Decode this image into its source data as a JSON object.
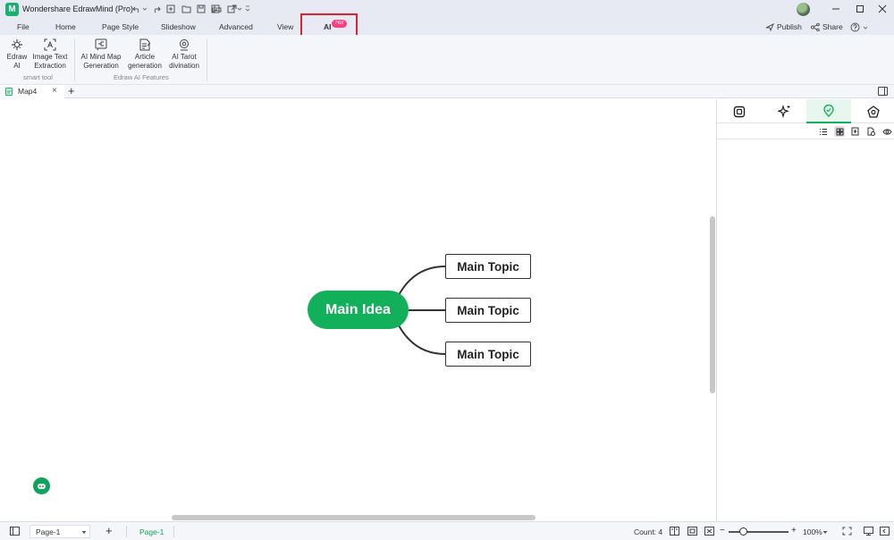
{
  "app": {
    "logo": "M",
    "title": "Wondershare EdrawMind (Pro)"
  },
  "quick_access": [
    "undo-icon",
    "undo-dropdown-icon",
    "redo-icon",
    "new-icon",
    "open-folder-icon",
    "save-icon",
    "export-icon",
    "print-icon",
    "share-export-icon",
    "customize-icon"
  ],
  "menu": {
    "items": [
      "File",
      "Home",
      "Page Style",
      "Slideshow",
      "Advanced",
      "View",
      "AI"
    ],
    "active": "AI",
    "hot_badge": "Hot",
    "publish": "Publish",
    "share": "Share",
    "help": "?"
  },
  "ribbon": {
    "groups": [
      {
        "label": "smart tool",
        "tools": [
          {
            "line1": "Edraw",
            "line2": "AI"
          },
          {
            "line1": "Image Text",
            "line2": "Extraction"
          }
        ]
      },
      {
        "label": "Edraw AI Features",
        "tools": [
          {
            "line1": "AI Mind Map",
            "line2": "Generation"
          },
          {
            "line1": "Article",
            "line2": "generation"
          },
          {
            "line1": "AI Tarot",
            "line2": "divination"
          }
        ]
      }
    ]
  },
  "tabs": {
    "document": "Map4",
    "close": "×",
    "add": "+"
  },
  "mindmap": {
    "main_idea": "Main Idea",
    "topics": [
      "Main Topic",
      "Main Topic",
      "Main Topic"
    ],
    "colors": {
      "root": "#12b05a",
      "border": "#333333"
    }
  },
  "right_panel": {
    "tabs": [
      "page-format-icon",
      "ai-sparkle-icon",
      "location-pin-icon",
      "theme-icon"
    ],
    "active_tab": 2,
    "tools": [
      "outline-list-icon",
      "grid-view-icon",
      "add-page-icon",
      "add-note-icon",
      "preview-eye-icon"
    ]
  },
  "status": {
    "page_select": "Page-1",
    "add_page": "+",
    "page_tab": "Page-1",
    "count": "Count: 4",
    "zoom": "100%",
    "zoom_out": "−",
    "zoom_in": "+"
  },
  "accent_color": "#12b05a"
}
